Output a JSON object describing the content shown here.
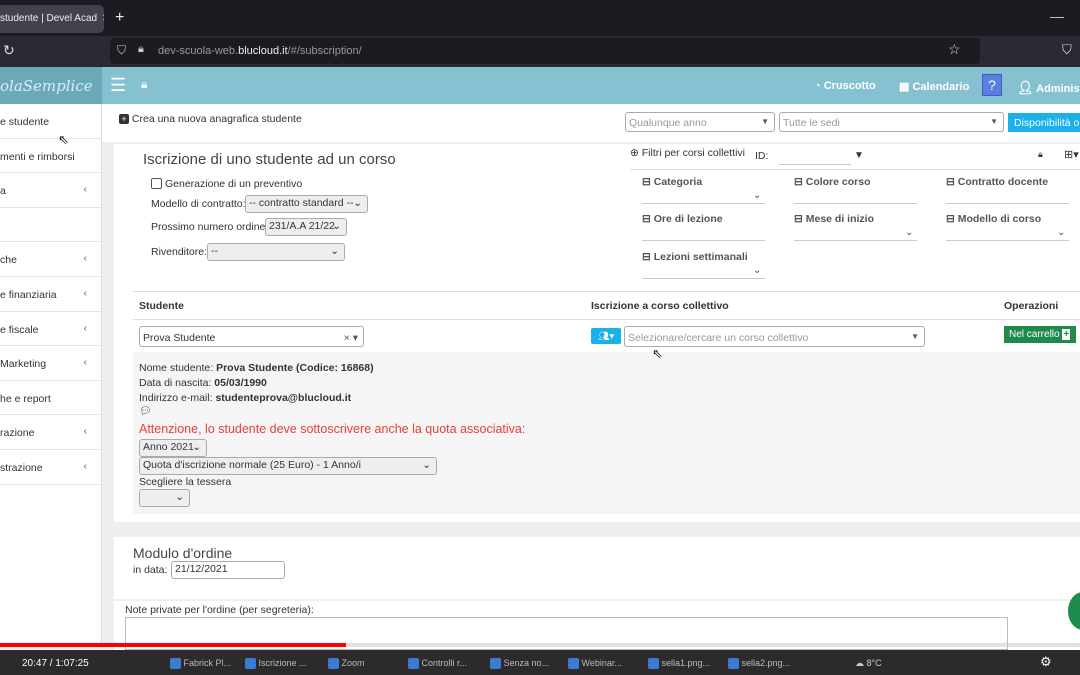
{
  "browser": {
    "tab_title": "studente | Devel Acad",
    "new_tab": "+",
    "url_prefix": "dev-scuola-web.",
    "url_domain": "blucloud.it",
    "url_suffix": "/#/subscription/"
  },
  "header": {
    "logo": "olaSemplice",
    "dashboard": "Cruscotto",
    "calendar": "Calendario",
    "help": "?",
    "user": "Administ"
  },
  "sidebar": {
    "items": [
      {
        "label": "e studente",
        "chevron": false
      },
      {
        "label": "menti e rimborsi",
        "chevron": false
      },
      {
        "label": "a",
        "chevron": true
      },
      {
        "label": "",
        "chevron": false
      },
      {
        "label": "che",
        "chevron": true
      },
      {
        "label": "e finanziaria",
        "chevron": true
      },
      {
        "label": "e fiscale",
        "chevron": true
      },
      {
        "label": "Marketing",
        "chevron": true
      },
      {
        "label": "he e report",
        "chevron": false
      },
      {
        "label": "razione",
        "chevron": true
      },
      {
        "label": "strazione",
        "chevron": true
      }
    ]
  },
  "toolbar": {
    "new_student": "Crea una nuova anagrafica studente",
    "year_placeholder": "Qualunque anno",
    "sites_placeholder": "Tutte le sedi",
    "availability": "Disponibilità o"
  },
  "form": {
    "title": "Iscrizione di uno studente ad un corso",
    "quote_checkbox": "Generazione di un preventivo",
    "quote_checked": false,
    "contract_label": "Modello di contratto:",
    "contract_value": "-- contratto standard --",
    "order_label": "Prossimo numero ordine:",
    "order_value": "231/A.A 21/22",
    "reseller_label": "Rivenditore:",
    "reseller_value": "--"
  },
  "filters": {
    "title": "Filtri per corsi collettivi",
    "id_label": "ID:",
    "items": [
      "Categoria",
      "Colore corso",
      "Contratto docente",
      "Ore di lezione",
      "Mese di inizio",
      "Modello di corso",
      "Lezioni settimanali"
    ]
  },
  "table": {
    "col_student": "Studente",
    "col_course": "Iscrizione a corso collettivo",
    "col_ops": "Operazioni",
    "student_value": "Prova Studente",
    "course_placeholder": "Selezionare/cercare un corso collettivo",
    "cart_button": "Nel carrello"
  },
  "student": {
    "name_label": "Nome studente:",
    "name_value": "Prova Studente (Codice: 16868)",
    "birth_label": "Data di nascita:",
    "birth_value": "05/03/1990",
    "email_label": "Indirizzo e-mail:",
    "email_value": "studenteprova@blucloud.it",
    "warning": "Attenzione, lo studente deve sottoscrivere anche la quota associativa:",
    "year_value": "Anno 2021",
    "fee_value": "Quota d'iscrizione normale (25 Euro) - 1 Anno/i",
    "card_label": "Scegliere la tessera"
  },
  "order": {
    "title": "Modulo d'ordine",
    "date_label": "in data:",
    "date_value": "21/12/2021",
    "notes_label": "Note private per l'ordine (per segreteria):"
  },
  "video": {
    "time": "20:47 / 1:07:25",
    "progress": 0.32
  },
  "taskbar": {
    "items": [
      "Fabrick Pl...",
      "Iscrizione ...",
      "Zoom",
      "Controlli r...",
      "Senza no...",
      "Webinar...",
      "sella1.png...",
      "sella2.png..."
    ],
    "weather": "8°C"
  },
  "colors": {
    "header": "#86c1d1",
    "accent_blue": "#1ab0e8",
    "cart_green": "#1e8a4c",
    "warning_red": "#e8403a",
    "progress_red": "#ff0000"
  }
}
